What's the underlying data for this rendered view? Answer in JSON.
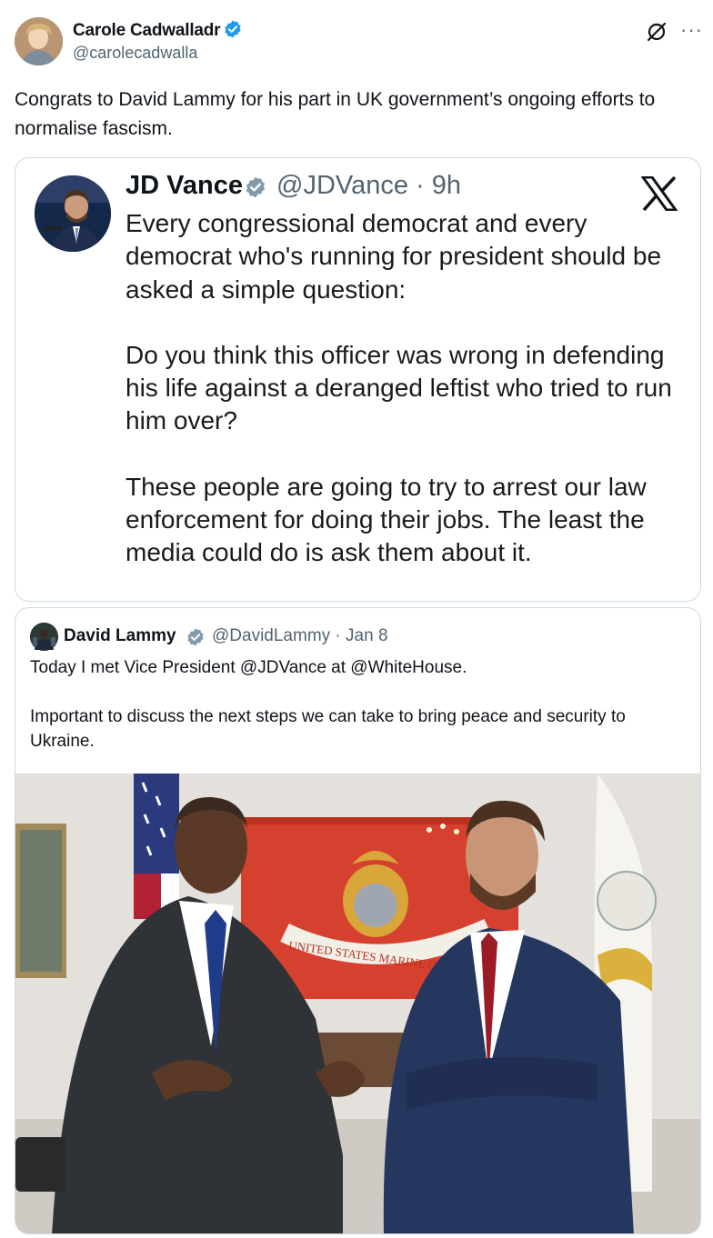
{
  "author": {
    "name": "Carole Cadwalladr",
    "handle": "@carolecadwalla"
  },
  "tweet": {
    "text": "Congrats to David Lammy for his part in UK government’s ongoing efforts to normalise fascism."
  },
  "header_icons": {
    "grok": "grok-icon",
    "more": "···"
  },
  "embedded_screenshot": {
    "name": "JD Vance",
    "handle": "@JDVance · 9h",
    "paragraphs": [
      "Every congressional democrat and every democrat who's running for president should be asked a simple question:",
      "Do you think this officer was wrong in defending his life against a deranged leftist who tried to run him over?",
      "These people are going to try to arrest our law enforcement for doing their jobs. The least the media could do is ask them about it."
    ]
  },
  "quoted_tweet": {
    "name": "David Lammy",
    "handle": "@DavidLammy · Jan 8",
    "paragraphs": [
      "Today I met Vice President @JDVance at @WhiteHouse.",
      "Important to discuss the next steps we can take to bring peace and security to Ukraine."
    ],
    "photo_banner_text": "UNITED STATES MARINE C"
  },
  "colors": {
    "verified_blue": "#1d9bf0",
    "verified_gray": "#829aab",
    "text_primary": "#0f1419",
    "text_secondary": "#536471",
    "border": "#cfd9de"
  }
}
